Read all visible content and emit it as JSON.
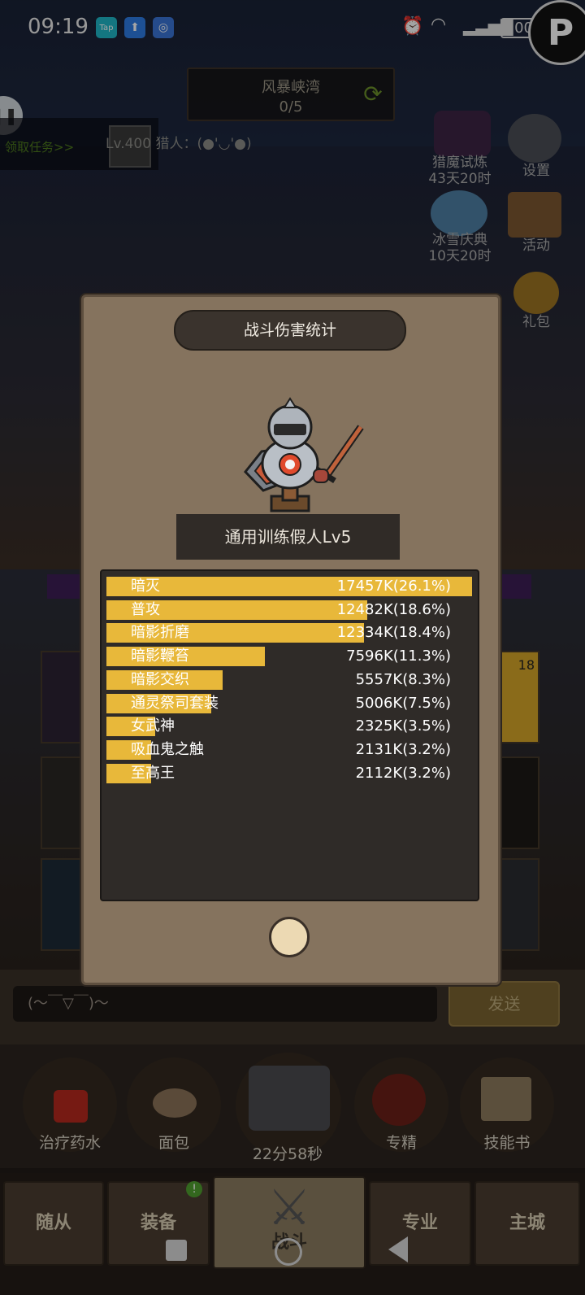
{
  "status_bar": {
    "time": "09:19",
    "app_icons": [
      "Tap",
      "⬆",
      "◎"
    ],
    "battery": "100"
  },
  "game": {
    "zone": {
      "name": "风暴峡湾",
      "progress": "0/5"
    },
    "quest_link": "领取任务>>",
    "player": {
      "level_name": "Lv.400 猎人：(●'◡'●)"
    },
    "side_menu": [
      {
        "label": "猎魔试炼",
        "sub": "43天20时"
      },
      {
        "label": "冰雪庆典",
        "sub": "10天20时"
      },
      {
        "label": "设置"
      },
      {
        "label": "活动"
      },
      {
        "label": "礼包"
      }
    ],
    "chat": {
      "input_text": "(～￣▽￣)～",
      "send_label": "发送"
    },
    "items": [
      {
        "label": "治疗药水"
      },
      {
        "label": "面包"
      },
      {
        "label": "22分58秒"
      },
      {
        "label": "专精"
      },
      {
        "label": "技能书"
      }
    ],
    "nav": [
      {
        "label": "随从"
      },
      {
        "label": "装备",
        "badge": "!"
      },
      {
        "label": "战斗"
      },
      {
        "label": "专业"
      },
      {
        "label": "主城"
      }
    ],
    "slot_badge": "18"
  },
  "modal": {
    "title": "战斗伤害统计",
    "target": "通用训练假人Lv5",
    "stats": [
      {
        "name": "暗灭",
        "value": "17457K(26.1%)",
        "share": 26.1
      },
      {
        "name": "普攻",
        "value": "12482K(18.6%)",
        "share": 18.6
      },
      {
        "name": "暗影折磨",
        "value": "12334K(18.4%)",
        "share": 18.4
      },
      {
        "name": "暗影鞭笞",
        "value": "7596K(11.3%)",
        "share": 11.3
      },
      {
        "name": "暗影交织",
        "value": "5557K(8.3%)",
        "share": 8.3
      },
      {
        "name": "通灵祭司套装",
        "value": "5006K(7.5%)",
        "share": 7.5
      },
      {
        "name": "女武神",
        "value": "2325K(3.5%)",
        "share": 3.5
      },
      {
        "name": "吸血鬼之触",
        "value": "2131K(3.2%)",
        "share": 3.2
      },
      {
        "name": "至高王",
        "value": "2112K(3.2%)",
        "share": 3.2
      }
    ]
  },
  "colors": {
    "bar": "#e8b83a",
    "panel": "#85735e"
  }
}
